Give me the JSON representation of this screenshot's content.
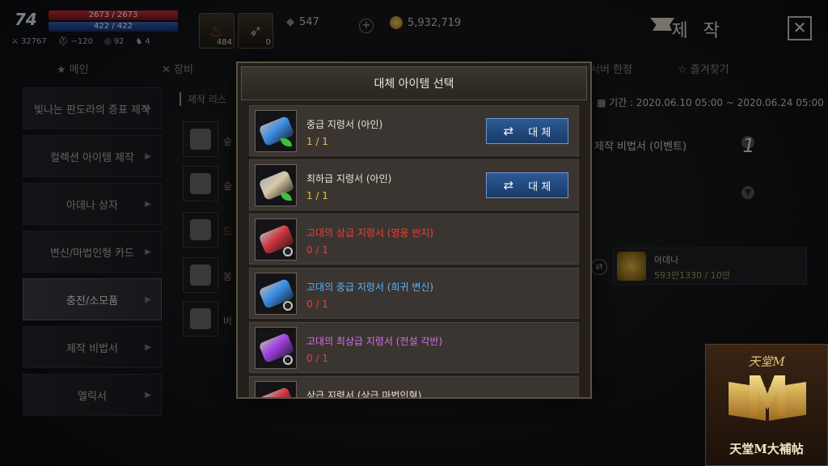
{
  "hud": {
    "level": "74",
    "hp": "2673 / 2673",
    "mp": "422 / 422",
    "stats": [
      "32767",
      "−120",
      "92",
      "4"
    ],
    "slots": [
      {
        "count": "484",
        "icon": "health-potion-icon"
      },
      {
        "count": "0",
        "icon": "feather-icon"
      }
    ],
    "stones": "547",
    "adena": "5,932,719"
  },
  "header": {
    "title": "제 작"
  },
  "tabs": [
    "메인",
    "장비",
    "서버 한정",
    "즐겨찾기"
  ],
  "nav": [
    {
      "label": "빛나는 판도라의 증표 제작",
      "active": false
    },
    {
      "label": "컬렉션 아이템 제작",
      "active": false
    },
    {
      "label": "아데나 상자",
      "active": false
    },
    {
      "label": "변신/마법인형 카드",
      "active": false
    },
    {
      "label": "충전/소모품",
      "active": true
    },
    {
      "label": "제작 비법서",
      "active": false
    },
    {
      "label": "엘릭서",
      "active": false
    }
  ],
  "list": {
    "header": "제작 리스",
    "thumb_letters": [
      "숲",
      "숲",
      "드",
      "봉",
      "버"
    ]
  },
  "detail": {
    "period": "기간 : 2020.06.10 05:00 ~ 2020.06.24 05:00",
    "recipe": "제작 비법서 (이벤트)",
    "quantity": "1",
    "material": {
      "name": "아데나",
      "value": "593만1330 / 10만"
    }
  },
  "modal": {
    "title": "대체 아이템 선택",
    "replace_label": "대 체",
    "items": [
      {
        "name": "중급 지령서 (아인)",
        "count": "1 / 1",
        "name_color": "#e8e2d4",
        "count_color": "#e2c24a",
        "scroll_color": "#3b8ee6",
        "badge": "leaf",
        "has_button": true
      },
      {
        "name": "최하급 지령서 (아인)",
        "count": "1 / 1",
        "name_color": "#e8e2d4",
        "count_color": "#e2c24a",
        "scroll_color": "#d8c9a8",
        "badge": "leaf",
        "has_button": true
      },
      {
        "name": "고대의 상급 지령서 (영웅 반지)",
        "count": "0 / 1",
        "name_color": "#e6423a",
        "count_color": "#e6423a",
        "scroll_color": "#d23440",
        "badge": "ring",
        "has_button": false
      },
      {
        "name": "고대의 중급 지령서 (희귀 변신)",
        "count": "0 / 1",
        "name_color": "#58b3ff",
        "count_color": "#e6423a",
        "scroll_color": "#3b8ee6",
        "badge": "ring",
        "has_button": false
      },
      {
        "name": "고대의 최상급 지령서 (전설 각반)",
        "count": "0 / 1",
        "name_color": "#d66cf0",
        "count_color": "#e6423a",
        "scroll_color": "#a040e0",
        "badge": "ring",
        "has_button": false
      },
      {
        "name": "상급 지령서 (상급 마법인형)",
        "count": "",
        "name_color": "#e8e2d4",
        "count_color": "#e6423a",
        "scroll_color": "#d23440",
        "badge": "none",
        "has_button": false
      }
    ]
  },
  "watermark": {
    "top": "天堂M",
    "bottom": "天堂M大補帖"
  }
}
